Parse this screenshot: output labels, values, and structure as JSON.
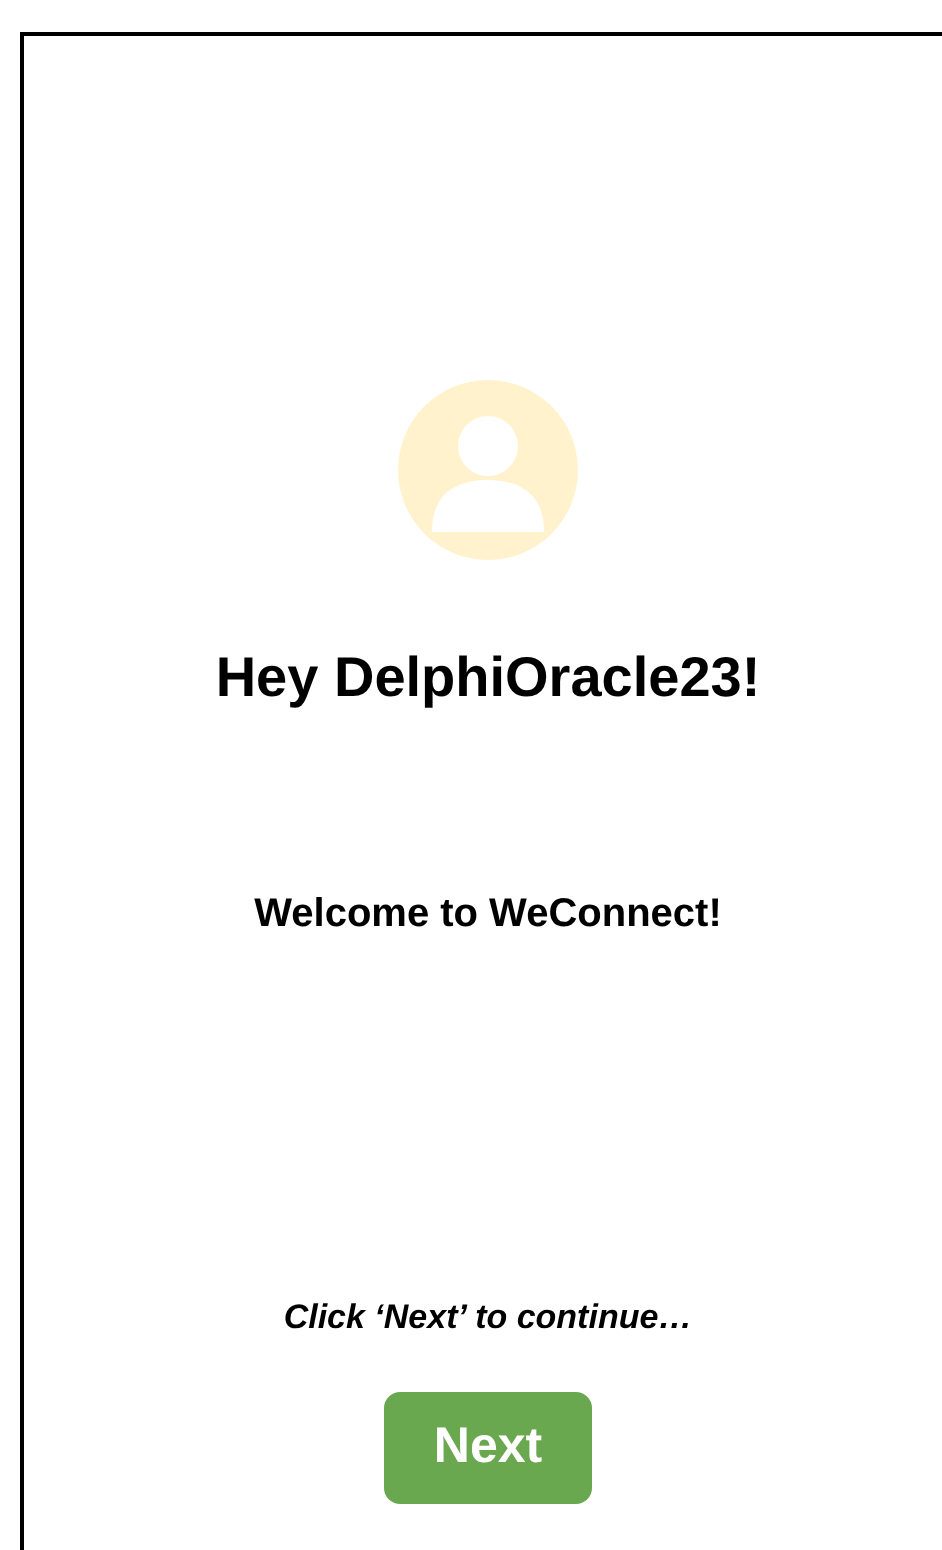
{
  "greeting": "Hey DelphiOracle23!",
  "welcome": "Welcome to WeConnect!",
  "hint": "Click ‘Next’ to continue…",
  "button": "Next"
}
